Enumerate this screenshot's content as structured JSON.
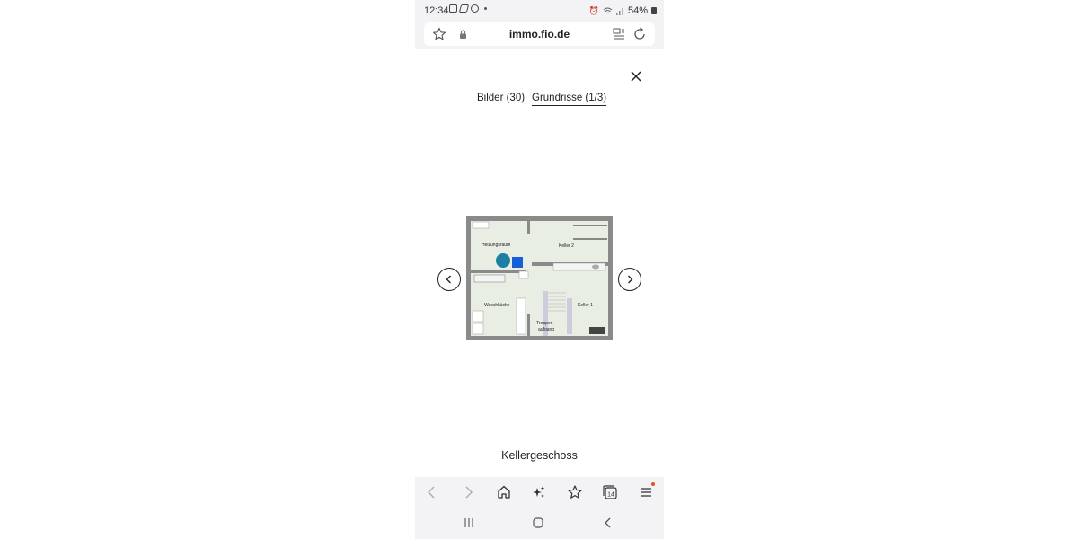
{
  "status_bar": {
    "time": "12:34",
    "battery": "54%",
    "notification_icons": [
      "image-icon",
      "leaf-icon",
      "box-icon"
    ],
    "system_icons": [
      "alarm-icon",
      "wifi-icon",
      "signal-icon",
      "battery-icon"
    ]
  },
  "browser": {
    "url": "immo.fio.de",
    "icons": [
      "star-icon",
      "lock-icon",
      "reader-icon",
      "reload-icon"
    ]
  },
  "gallery": {
    "tabs": [
      {
        "label": "Bilder (30)",
        "active": false
      },
      {
        "label": "Grundrisse (1/3)",
        "active": true
      }
    ],
    "caption": "Kellergeschoss",
    "floor_plan": {
      "rooms": [
        "Heizungsraum",
        "Keller 2",
        "Waschküche",
        "Treppen-",
        "aufgang",
        "Keller 1"
      ]
    }
  },
  "toolbar": {
    "items": [
      "back-icon",
      "forward-icon",
      "home-icon",
      "sparkle-icon",
      "bookmark-icon",
      "tabs-icon",
      "menu-icon"
    ],
    "tabs_count": "14",
    "menu_badge_color": "#e8501f"
  },
  "system_nav": {
    "items": [
      "recent-apps-icon",
      "home-icon",
      "back-icon"
    ]
  }
}
